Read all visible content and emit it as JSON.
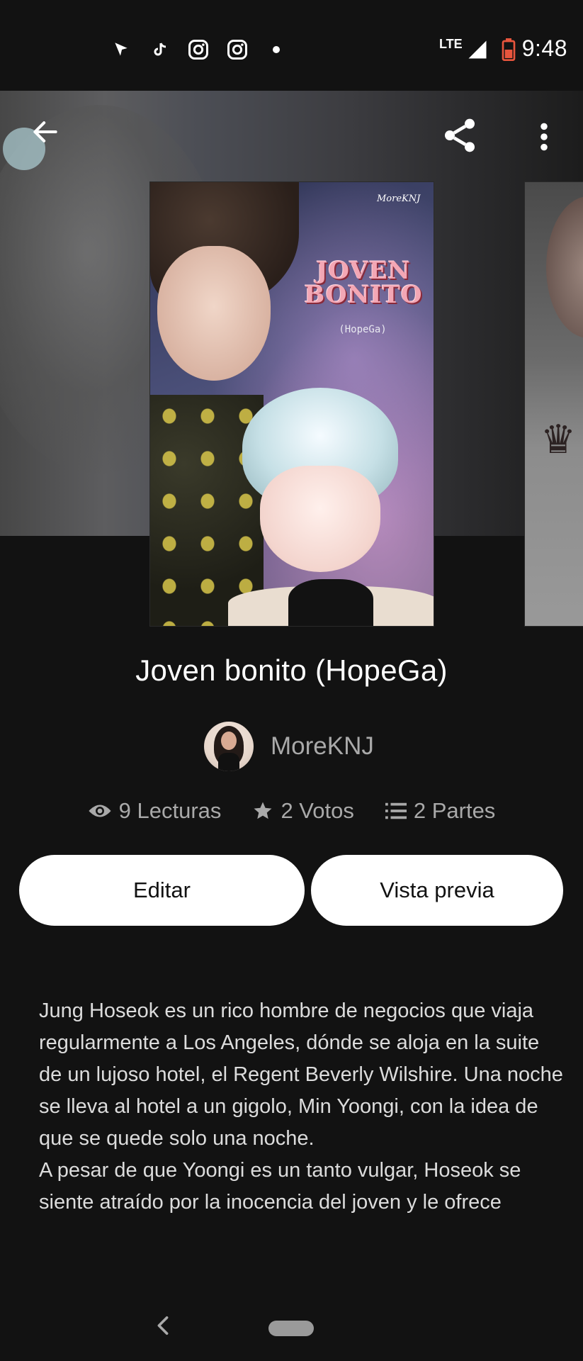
{
  "status_bar": {
    "time": "9:48",
    "network": "LTE",
    "icons": [
      "navigation-icon",
      "tiktok-icon",
      "instagram-icon",
      "instagram-icon",
      "dot-icon",
      "signal-icon",
      "battery-icon"
    ]
  },
  "header": {
    "back_icon": "arrow-left-icon",
    "share_icon": "share-icon",
    "more_icon": "more-vertical-icon"
  },
  "cover": {
    "title_line1": "JOVEN",
    "title_line2": "BONITO",
    "subtitle": "(HopeGa)",
    "watermark": "MoreKNJ"
  },
  "story": {
    "title": "Joven bonito (HopeGa)",
    "author": "MoreKNJ"
  },
  "stats": {
    "reads": "9 Lecturas",
    "votes": "2 Votos",
    "parts": "2 Partes"
  },
  "actions": {
    "edit": "Editar",
    "preview": "Vista previa"
  },
  "description": "Jung Hoseok es un rico hombre de negocios que viaja regularmente a Los Angeles, dónde se aloja en la suite de un lujoso hotel, el Regent Beverly Wilshire. Una noche se lleva al hotel a un gigolo, Min Yoongi, con la idea de que se quede solo una noche.\nA pesar de que Yoongi es un tanto vulgar, Hoseok se siente atraído por la inocencia del joven y le ofrece",
  "colors": {
    "background": "#121212",
    "button_bg": "#ffffff",
    "muted_text": "#a9a9a9"
  }
}
